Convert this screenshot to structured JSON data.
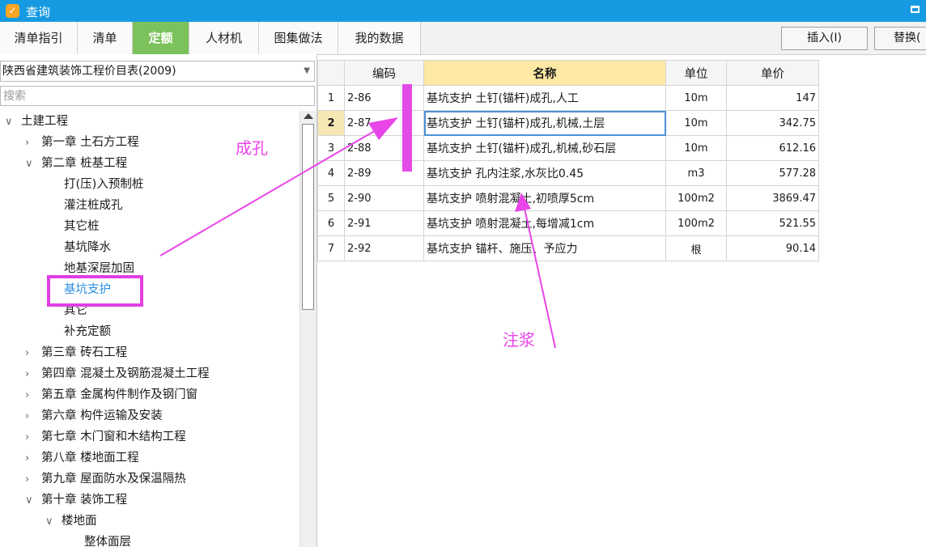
{
  "window": {
    "title": "查询",
    "app_icon": "app-logo-icon"
  },
  "tabs": [
    {
      "label": "清单指引",
      "active": false
    },
    {
      "label": "清单",
      "active": false
    },
    {
      "label": "定额",
      "active": true
    },
    {
      "label": "人材机",
      "active": false
    },
    {
      "label": "图集做法",
      "active": false
    },
    {
      "label": "我的数据",
      "active": false
    }
  ],
  "toolbar": {
    "insert_label": "插入(I)",
    "replace_label": "替换("
  },
  "left_panel": {
    "library_select": "陕西省建筑装饰工程价目表(2009)",
    "search_placeholder": "搜索",
    "tree": [
      {
        "label": "土建工程",
        "toggle": "expanded",
        "level": 0
      },
      {
        "label": "第一章 土石方工程",
        "toggle": "collapsed",
        "level": 1
      },
      {
        "label": "第二章 桩基工程",
        "toggle": "expanded",
        "level": 1
      },
      {
        "label": "打(压)入预制桩",
        "toggle": "none",
        "level": 2
      },
      {
        "label": "灌注桩成孔",
        "toggle": "none",
        "level": 2
      },
      {
        "label": "其它桩",
        "toggle": "none",
        "level": 2
      },
      {
        "label": "基坑降水",
        "toggle": "none",
        "level": 2
      },
      {
        "label": "地基深层加固",
        "toggle": "none",
        "level": 2
      },
      {
        "label": "基坑支护",
        "toggle": "none",
        "level": 2,
        "selected": true
      },
      {
        "label": "其它",
        "toggle": "none",
        "level": 2
      },
      {
        "label": "补充定额",
        "toggle": "none",
        "level": 2
      },
      {
        "label": "第三章 砖石工程",
        "toggle": "collapsed",
        "level": 1
      },
      {
        "label": "第四章 混凝土及钢筋混凝土工程",
        "toggle": "collapsed",
        "level": 1
      },
      {
        "label": "第五章 金属构件制作及钢门窗",
        "toggle": "collapsed",
        "level": 1
      },
      {
        "label": "第六章 构件运输及安装",
        "toggle": "collapsed",
        "level": 1
      },
      {
        "label": "第七章 木门窗和木结构工程",
        "toggle": "collapsed",
        "level": 1
      },
      {
        "label": "第八章 楼地面工程",
        "toggle": "collapsed",
        "level": 1
      },
      {
        "label": "第九章 屋面防水及保温隔热",
        "toggle": "collapsed",
        "level": 1
      },
      {
        "label": "第十章 装饰工程",
        "toggle": "expanded",
        "level": 1
      },
      {
        "label": "楼地面",
        "toggle": "expanded",
        "level": 2
      },
      {
        "label": "整体面层",
        "toggle": "none",
        "level": 3
      }
    ]
  },
  "grid": {
    "headers": {
      "code": "编码",
      "name": "名称",
      "unit": "单位",
      "price": "单价"
    },
    "current_row": 2,
    "rows": [
      {
        "no": "1",
        "code": "2-86",
        "name": "基坑支护 土钉(锚杆)成孔,人工",
        "unit": "10m",
        "price": "147"
      },
      {
        "no": "2",
        "code": "2-87",
        "name": "基坑支护 土钉(锚杆)成孔,机械,土层",
        "unit": "10m",
        "price": "342.75"
      },
      {
        "no": "3",
        "code": "2-88",
        "name": "基坑支护 土钉(锚杆)成孔,机械,砂石层",
        "unit": "10m",
        "price": "612.16"
      },
      {
        "no": "4",
        "code": "2-89",
        "name": "基坑支护 孔内注浆,水灰比0.45",
        "unit": "m3",
        "price": "577.28"
      },
      {
        "no": "5",
        "code": "2-90",
        "name": "基坑支护 喷射混凝土,初喷厚5cm",
        "unit": "100m2",
        "price": "3869.47"
      },
      {
        "no": "6",
        "code": "2-91",
        "name": "基坑支护 喷射混凝土,每增减1cm",
        "unit": "100m2",
        "price": "521.55"
      },
      {
        "no": "7",
        "code": "2-92",
        "name": "基坑支护 锚杆、施压、予应力",
        "unit": "根",
        "price": "90.14"
      }
    ]
  },
  "annotations": {
    "label_hole": "成孔",
    "label_grout": "注浆",
    "color": "#e845e8"
  }
}
